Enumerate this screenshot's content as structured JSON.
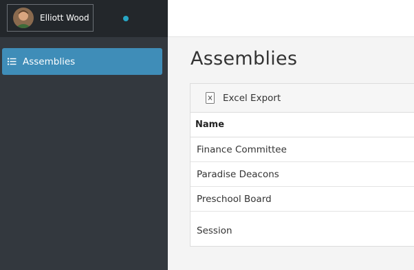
{
  "user": {
    "name": "Elliott Wood"
  },
  "sidebar": {
    "items": [
      {
        "label": "Assemblies",
        "icon": "list-icon"
      }
    ]
  },
  "page": {
    "title": "Assemblies"
  },
  "toolbar": {
    "export_label": "Excel Export",
    "export_icon": "excel-file-icon"
  },
  "grid": {
    "columns": [
      "Name"
    ],
    "rows": [
      "Finance Committee",
      "Paradise Deacons",
      "Preschool Board",
      "Session"
    ]
  },
  "colors": {
    "sidebar_bg": "#33383e",
    "sidebar_top_bg": "#23272b",
    "active_item": "#3f8db8",
    "status_dot": "#27a6c4"
  }
}
